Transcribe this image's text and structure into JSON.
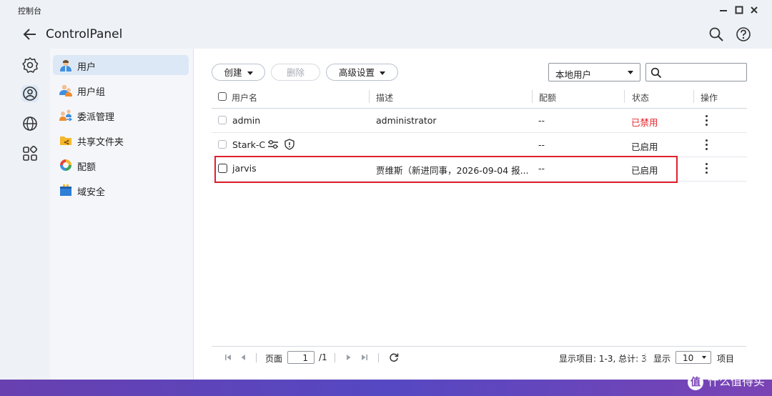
{
  "window": {
    "title": "控制台"
  },
  "header": {
    "app_name": "ControlPanel"
  },
  "sidebar": {
    "items": [
      {
        "label": "用户",
        "icon": "user-icon",
        "active": true
      },
      {
        "label": "用户组",
        "icon": "user-group-icon",
        "active": false
      },
      {
        "label": "委派管理",
        "icon": "delegation-icon",
        "active": false
      },
      {
        "label": "共享文件夹",
        "icon": "shared-folder-icon",
        "active": false
      },
      {
        "label": "配额",
        "icon": "quota-icon",
        "active": false
      },
      {
        "label": "域安全",
        "icon": "domain-security-icon",
        "active": false
      }
    ]
  },
  "toolbar": {
    "create_label": "创建",
    "delete_label": "删除",
    "advanced_label": "高级设置",
    "scope_select": "本地用户",
    "search_placeholder": ""
  },
  "table": {
    "columns": [
      "用户名",
      "描述",
      "配额",
      "状态",
      "操作"
    ],
    "rows": [
      {
        "username": "admin",
        "description": "administrator",
        "quota": "--",
        "status": "已禁用",
        "status_color": "#e4262c"
      },
      {
        "username": "Stark-C",
        "description": "",
        "quota": "--",
        "status": "已启用",
        "status_color": "#222222"
      },
      {
        "username": "jarvis",
        "description": "贾维斯（新进同事，2026-09-04 报...",
        "quota": "--",
        "status": "已启用",
        "status_color": "#222222"
      }
    ]
  },
  "pager": {
    "page_label": "页面",
    "page_value": "1",
    "page_total": "/1",
    "summary": "显示项目: 1-3, 总计: 3",
    "show_label": "显示",
    "page_size": "10",
    "items_label": "项目"
  },
  "watermark": {
    "text": "什么值得买",
    "badge": "值"
  },
  "colors": {
    "accent": "#dde8f6",
    "highlight_border": "#e0202c",
    "disabled_text": "#e4262c"
  }
}
